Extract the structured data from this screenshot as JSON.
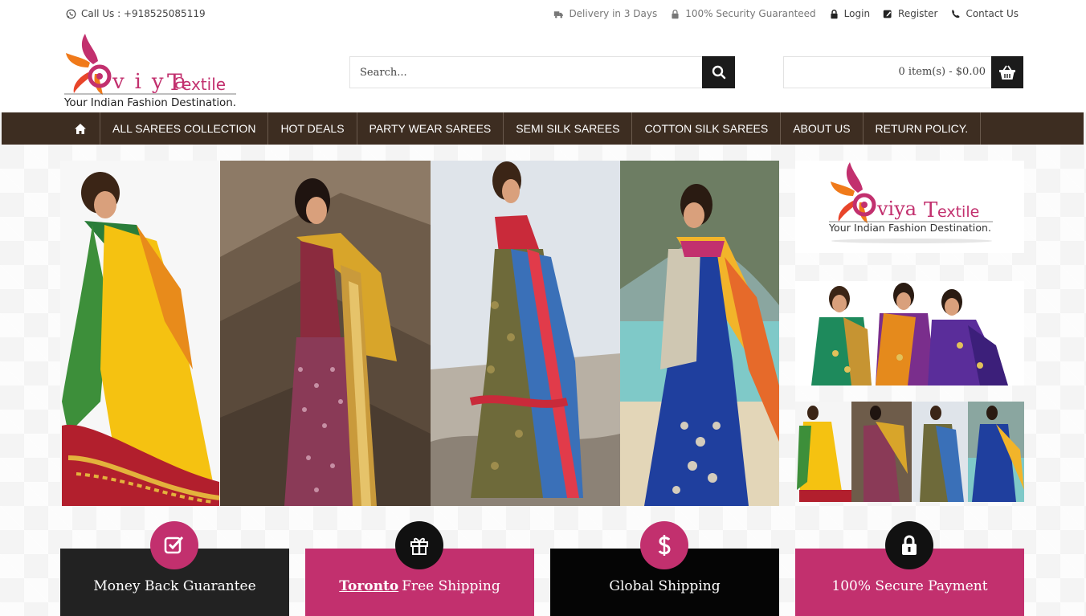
{
  "topbar": {
    "call": "Call Us : +918525085119",
    "delivery": "Delivery in 3 Days",
    "security": "100% Security Guaranteed",
    "login": "Login",
    "register": "Register",
    "contact": "Contact Us"
  },
  "logo": {
    "brand": "Oviya Textile",
    "tagline": "Your Indian Fashion Destination."
  },
  "search": {
    "placeholder": "Search..."
  },
  "cart": {
    "summary": "0 item(s) - $0.00"
  },
  "nav": {
    "items": [
      "ALL SAREES COLLECTION",
      "HOT DEALS",
      "PARTY WEAR SAREES",
      "SEMI SILK SAREES",
      "COTTON SILK SAREES",
      "ABOUT US",
      "RETURN POLICY."
    ]
  },
  "features": [
    {
      "label": "Money Back Guarantee",
      "icon": "check-square-icon",
      "color": "#222222",
      "circle": "#c2306e"
    },
    {
      "highlight": "Toronto",
      "label": "Free Shipping",
      "icon": "gift-icon",
      "color": "#c2306e",
      "circle": "#111111"
    },
    {
      "label": "Global Shipping",
      "icon": "dollar-icon",
      "color": "#050505",
      "circle": "#c2306e"
    },
    {
      "label": "100% Secure Payment",
      "icon": "lock-icon",
      "color": "#c2306e",
      "circle": "#111111"
    }
  ],
  "colors": {
    "accent": "#c2306e",
    "nav": "#3d2d21",
    "dark": "#1b1b1b"
  }
}
